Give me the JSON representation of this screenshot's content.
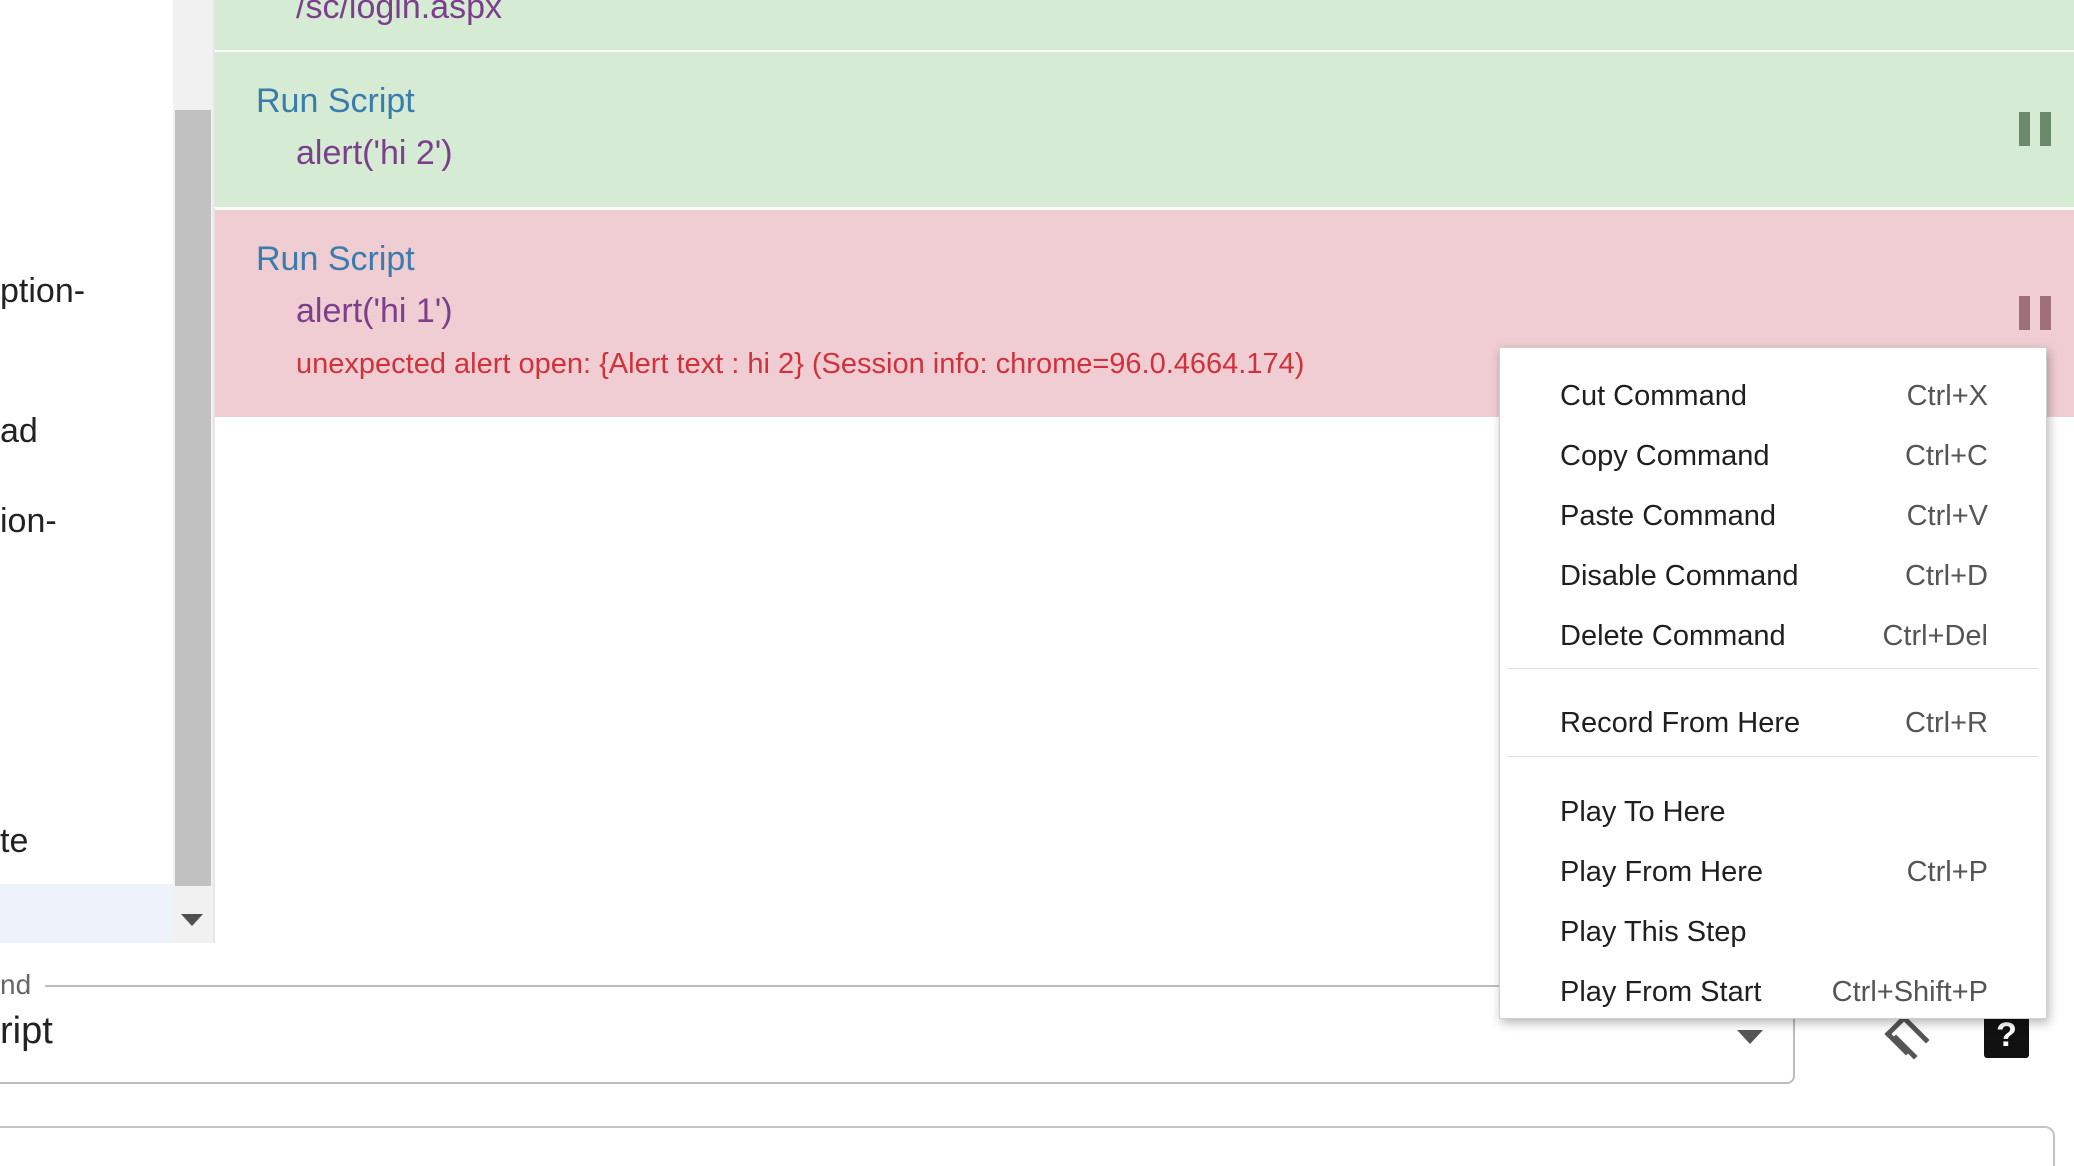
{
  "sidebar": {
    "items": [
      {
        "label": "ption-"
      },
      {
        "label": "ad"
      },
      {
        "label": "ion-"
      },
      {
        "label": "te"
      }
    ]
  },
  "commands": [
    {
      "target": "/sc/login.aspx",
      "status": "passed"
    },
    {
      "name": "Run Script",
      "target": "alert('hi 2')",
      "status": "passed"
    },
    {
      "name": "Run Script",
      "target": "alert('hi 1')",
      "status": "failed",
      "error": "unexpected alert open: {Alert text : hi 2} (Session info: chrome=96.0.4664.174)"
    }
  ],
  "command_field": {
    "legend": "nd",
    "value": "ript"
  },
  "context_menu": {
    "groups": [
      [
        {
          "label": "Cut Command",
          "shortcut": "Ctrl+X"
        },
        {
          "label": "Copy Command",
          "shortcut": "Ctrl+C"
        },
        {
          "label": "Paste Command",
          "shortcut": "Ctrl+V"
        },
        {
          "label": "Disable Command",
          "shortcut": "Ctrl+D"
        },
        {
          "label": "Delete Command",
          "shortcut": "Ctrl+Del"
        }
      ],
      [
        {
          "label": "Record From Here",
          "shortcut": "Ctrl+R"
        }
      ],
      [
        {
          "label": "Play To Here",
          "shortcut": ""
        },
        {
          "label": "Play From Here",
          "shortcut": "Ctrl+P"
        },
        {
          "label": "Play This Step",
          "shortcut": ""
        },
        {
          "label": "Play From Start",
          "shortcut": "Ctrl+Shift+P"
        }
      ]
    ]
  },
  "icons": {
    "breakpoint": "pause-icon",
    "select_target": "select-target-icon",
    "help": "help-icon",
    "help_glyph": "?"
  },
  "colors": {
    "passed_row": "#d5ebd3",
    "failed_row": "#efcdd3",
    "command_name": "#3a7cad",
    "error_text": "#d0323c",
    "pause_passed": "#6b8a6b",
    "pause_failed": "#a0707a"
  }
}
